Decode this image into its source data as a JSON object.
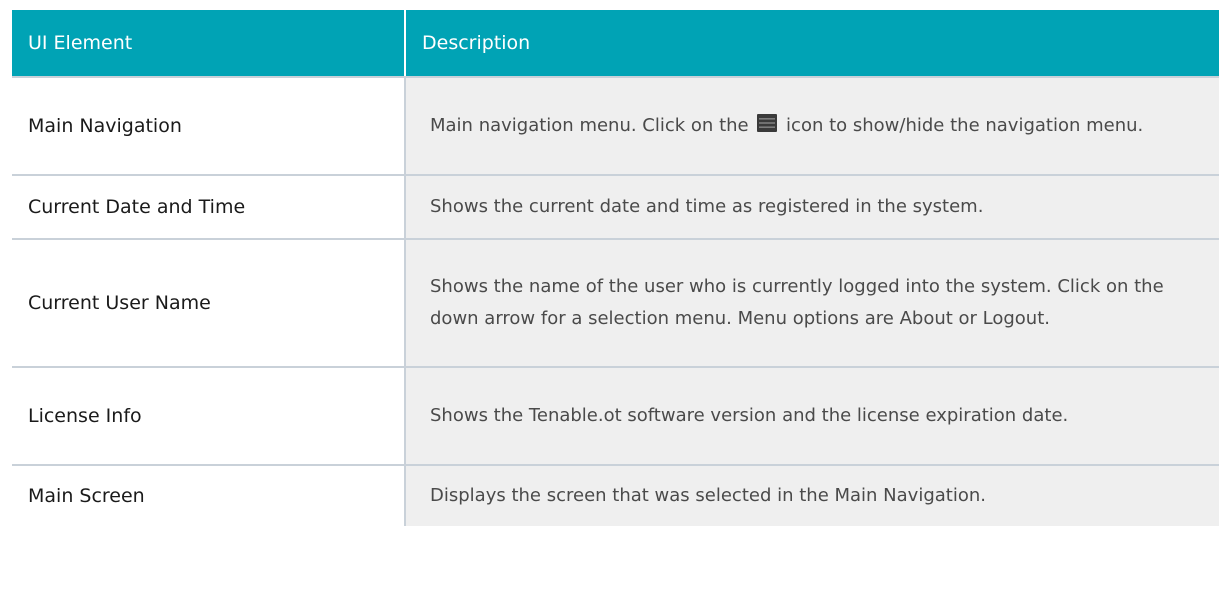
{
  "table": {
    "headers": {
      "element": "UI Element",
      "description": "Description"
    },
    "rows": [
      {
        "element": "Main Navigation",
        "desc_before": "Main navigation menu. Click on the",
        "icon": "menu-icon",
        "desc_after": "icon to show/hide the navigation menu."
      },
      {
        "element": "Current Date and Time",
        "description": "Shows the current date and time as registered in the system."
      },
      {
        "element": "Current User Name",
        "description": "Shows the name of the user who is currently logged into the system. Click on the down arrow for a selection menu. Menu options are About or Logout."
      },
      {
        "element": "License Info",
        "description": "Shows the Tenable.ot software version and the license expiration date."
      },
      {
        "element": "Main Screen",
        "description": "Displays the screen that was selected in the Main Navigation."
      }
    ]
  }
}
